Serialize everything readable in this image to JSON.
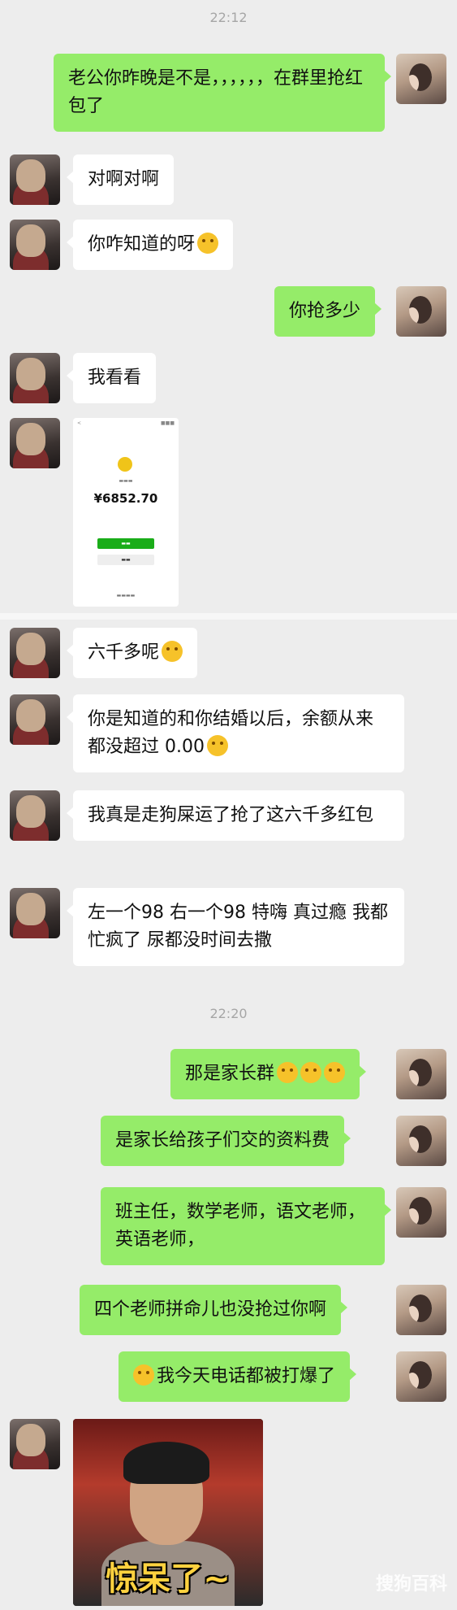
{
  "timestamps": [
    "22:12",
    "22:20"
  ],
  "messages": {
    "m1": {
      "text": "老公你昨晚是不是，，，，，，在群里抢红包了"
    },
    "m2": {
      "text": "对啊对啊"
    },
    "m3": {
      "text": "你咋知道的呀"
    },
    "m4": {
      "text": "你抢多少"
    },
    "m5": {
      "text": "我看看"
    },
    "m6": {
      "text": "六千多呢"
    },
    "m7": {
      "text": "你是知道的和你结婚以后，余额从来都没超过 0.00"
    },
    "m8": {
      "text": "我真是走狗屎运了抢了这六千多红包"
    },
    "m9": {
      "text": "左一个98  右一个98  特嗨  真过瘾  我都忙疯了  尿都没时间去撒"
    },
    "m10": {
      "text": "那是家长群"
    },
    "m11": {
      "text": "是家长给孩子们交的资料费"
    },
    "m12": {
      "text": "班主任，数学老师，语文老师，英语老师，"
    },
    "m13": {
      "text": "四个老师拼命儿也没抢过你啊"
    },
    "m14": {
      "text": "我今天电话都被打爆了"
    }
  },
  "wallet": {
    "amount": "¥6852.70"
  },
  "meme": {
    "caption": "惊呆了~"
  },
  "watermark": "搜狗百科",
  "colors": {
    "right_bubble": "#95ec69",
    "left_bubble": "#ffffff",
    "background": "#ededed",
    "timestamp": "#a6a6a6"
  }
}
